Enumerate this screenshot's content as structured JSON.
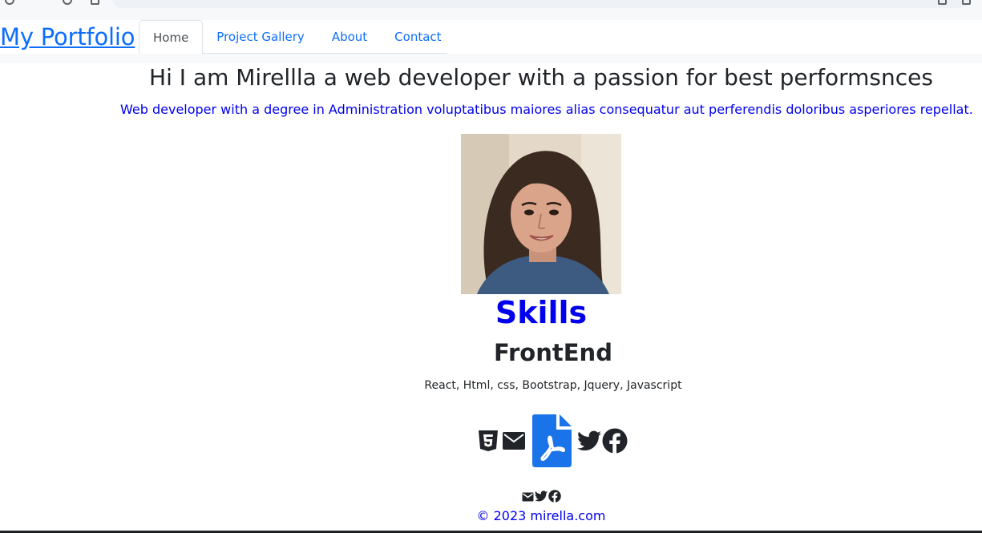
{
  "navbar": {
    "brand": "My Portfolio",
    "tabs": [
      {
        "label": "Home",
        "active": true
      },
      {
        "label": "Project Gallery",
        "active": false
      },
      {
        "label": "About",
        "active": false
      },
      {
        "label": "Contact",
        "active": false
      }
    ]
  },
  "hero": {
    "heading": "Hi I am Mirellla a web developer with a passion for best performsnces",
    "subtext": "Web developer with a degree in Administration voluptatibus maiores alias consequatur aut perferendis doloribus asperiores repellat."
  },
  "skills": {
    "title": "Skills",
    "frontend_title": "FrontEnd",
    "frontend_list": "React, Html, css, Bootstrap, Jquery, Javascript"
  },
  "icons": [
    "html5-icon",
    "email-icon",
    "pdf-icon",
    "twitter-icon",
    "facebook-icon"
  ],
  "footer": {
    "icons": [
      "email-icon",
      "twitter-icon",
      "facebook-icon"
    ],
    "copyright": "© 2023 mirella.com"
  },
  "colors": {
    "link_blue": "#0d6efd",
    "text_blue": "#0000ee",
    "pdf_blue": "#1a73e8",
    "text_dark": "#212529"
  }
}
